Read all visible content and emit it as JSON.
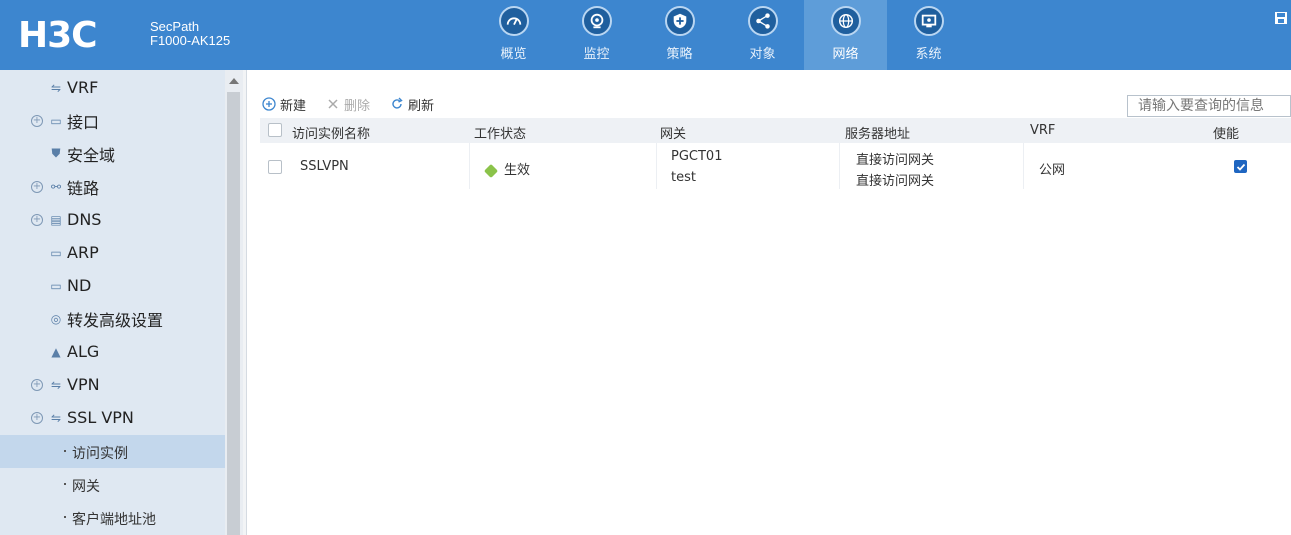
{
  "header": {
    "logo": "H3C",
    "product_line1": "SecPath",
    "product_line2": "F1000-AK125",
    "nav": [
      {
        "label": "概览",
        "icon": "dashboard-icon",
        "active": false
      },
      {
        "label": "监控",
        "icon": "monitor-camera-icon",
        "active": false
      },
      {
        "label": "策略",
        "icon": "shield-plus-icon",
        "active": false
      },
      {
        "label": "对象",
        "icon": "share-nodes-icon",
        "active": false
      },
      {
        "label": "网络",
        "icon": "globe-icon",
        "active": true
      },
      {
        "label": "系统",
        "icon": "screen-icon",
        "active": false
      }
    ]
  },
  "sidebar": {
    "items": [
      {
        "label": "VRF",
        "icon": "vrf-icon",
        "expandable": false
      },
      {
        "label": "接口",
        "icon": "interface-icon",
        "expandable": true
      },
      {
        "label": "安全域",
        "icon": "security-zone-icon",
        "expandable": false
      },
      {
        "label": "链路",
        "icon": "link-icon",
        "expandable": true
      },
      {
        "label": "DNS",
        "icon": "dns-icon",
        "expandable": true
      },
      {
        "label": "ARP",
        "icon": "arp-icon",
        "expandable": false
      },
      {
        "label": "ND",
        "icon": "nd-icon",
        "expandable": false
      },
      {
        "label": "转发高级设置",
        "icon": "forwarding-settings-icon",
        "expandable": false
      },
      {
        "label": "ALG",
        "icon": "alg-icon",
        "expandable": false
      },
      {
        "label": "VPN",
        "icon": "vpn-icon",
        "expandable": true
      },
      {
        "label": "SSL VPN",
        "icon": "ssl-vpn-icon",
        "expandable": true
      }
    ],
    "sub_items": [
      {
        "label": "访问实例",
        "active": true
      },
      {
        "label": "网关",
        "active": false
      },
      {
        "label": "客户端地址池",
        "active": false
      }
    ]
  },
  "toolbar": {
    "new_label": "新建",
    "delete_label": "删除",
    "refresh_label": "刷新",
    "search_placeholder": "请输入要查询的信息"
  },
  "table": {
    "columns": [
      "访问实例名称",
      "工作状态",
      "网关",
      "服务器地址",
      "VRF",
      "使能"
    ],
    "rows": [
      {
        "name": "SSLVPN",
        "status": "生效",
        "gateway_1": "PGCT01",
        "gateway_2": "test",
        "server_1": "直接访问网关",
        "server_2": "直接访问网关",
        "vrf": "公网",
        "enabled": true
      }
    ]
  },
  "colors": {
    "header": "#3d86cf",
    "nav_active": "#5e9dd9",
    "sidebar": "#dfe8f2",
    "sidebar_active": "#c3d7ec",
    "status_ok": "#8bc34a",
    "checkbox_on": "#1f66c1"
  }
}
